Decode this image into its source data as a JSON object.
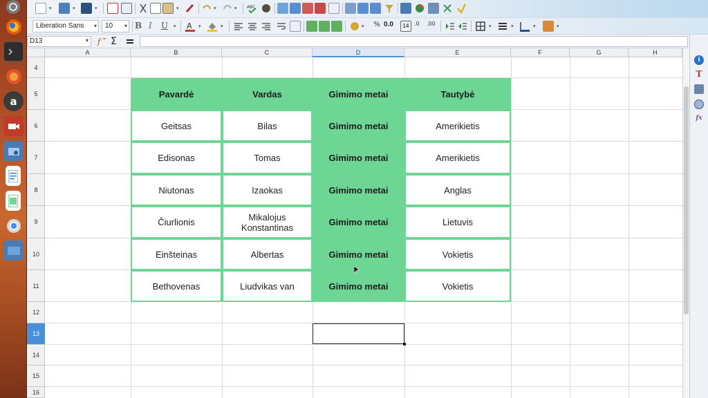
{
  "toolbar": {
    "font_name": "Liberation Sans",
    "font_size": "10",
    "number_format_label": "0.0",
    "decimal_label": "14"
  },
  "formula_bar": {
    "cell_reference": "D13",
    "formula_value": ""
  },
  "columns": [
    "A",
    "B",
    "C",
    "D",
    "E",
    "F",
    "G",
    "H"
  ],
  "active_column": "D",
  "rows": [
    "4",
    "5",
    "6",
    "7",
    "8",
    "9",
    "10",
    "11",
    "12",
    "13",
    "14",
    "15",
    "16"
  ],
  "active_row": "13",
  "table": {
    "headers": [
      "Pavardė",
      "Vardas",
      "Gimimo metai",
      "Tautybė"
    ],
    "rows": [
      [
        "Geitsas",
        "Bilas",
        "Gimimo metai",
        "Amerikietis"
      ],
      [
        "Edisonas",
        "Tomas",
        "Gimimo metai",
        "Amerikietis"
      ],
      [
        "Niutonas",
        "Izaokas",
        "Gimimo metai",
        "Anglas"
      ],
      [
        "Čiurlionis",
        "Mikalojus Konstantinas",
        "Gimimo metai",
        "Lietuvis"
      ],
      [
        "Einšteinas",
        "Albertas",
        "Gimimo metai",
        "Vokietis"
      ],
      [
        "Bethovenas",
        "Liudvikas van",
        "Gimimo metai",
        "Vokietis"
      ]
    ]
  },
  "colors": {
    "table_green": "#6dd694",
    "selection_blue": "#4a90d9",
    "launcher_orange": "#c9682f"
  },
  "icons": {
    "launcher": [
      "ubuntu-dash-icon",
      "firefox-icon",
      "terminal-icon",
      "browser-icon",
      "software-center-icon",
      "camera-icon",
      "screenshot-icon",
      "writer-icon",
      "calc-icon",
      "chrome-icon",
      "workspace-icon"
    ],
    "sidebar": [
      "properties-icon",
      "styles-icon",
      "gallery-icon",
      "navigator-icon",
      "functions-icon"
    ]
  }
}
